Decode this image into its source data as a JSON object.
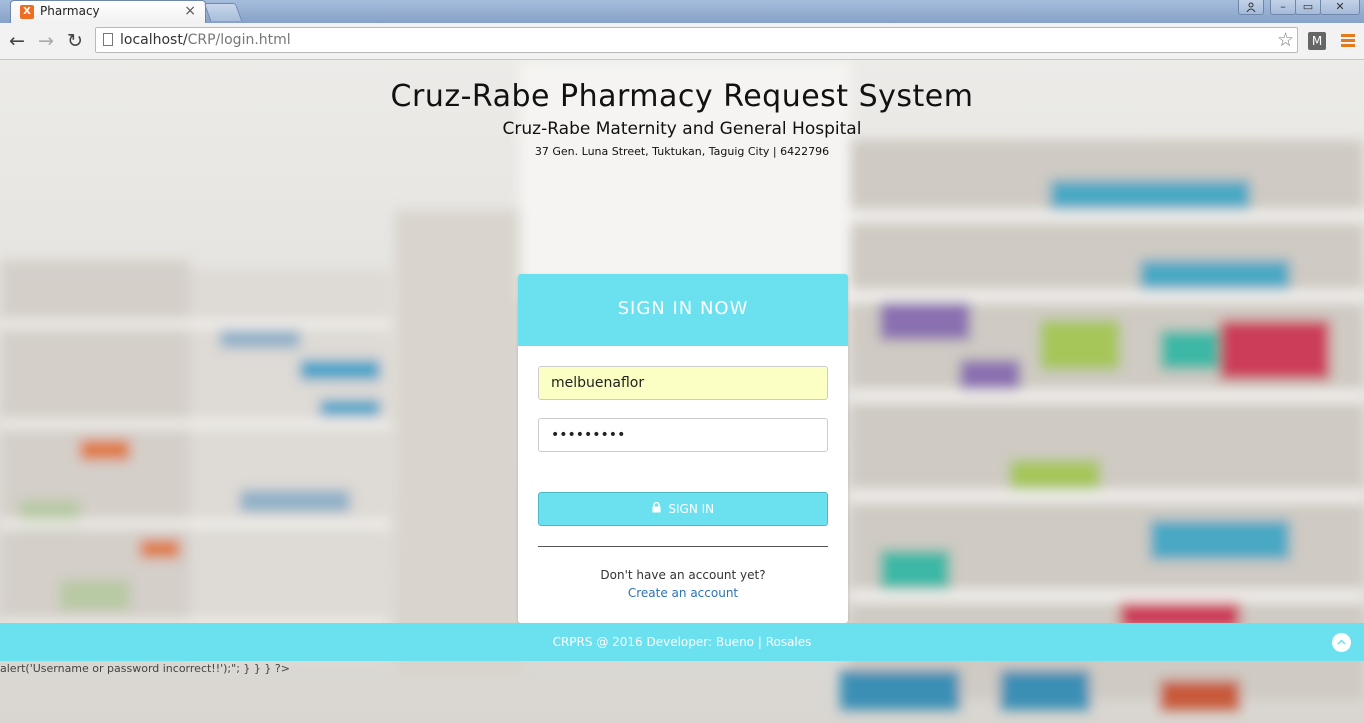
{
  "browser": {
    "tab_title": "Pharmacy",
    "tab_favicon_letter": "X",
    "tab_close": "×",
    "url_host": "localhost/",
    "url_path": "CRP/login.html",
    "back_icon": "←",
    "forward_icon": "→",
    "reload_icon": "↻",
    "star_icon": "☆",
    "extension_label": "M",
    "window_minimize": "–",
    "window_maximize": "▭",
    "window_close": "✕",
    "window_user": "👤"
  },
  "header": {
    "title": "Cruz-Rabe Pharmacy Request System",
    "subtitle": "Cruz-Rabe Maternity and General Hospital",
    "address": "37 Gen. Luna Street, Tuktukan, Taguig City | 6422796"
  },
  "login": {
    "heading": "SIGN IN NOW",
    "username_value": "melbuenaflor",
    "password_value": "•••••••••",
    "signin_label": "SIGN IN",
    "lock_icon": "🔒",
    "no_account_text": "Don't have an account yet?",
    "create_account_label": "Create an account"
  },
  "footer": {
    "text": "CRPRS @ 2016 Developer: Bueno | Rosales",
    "to_top_icon": "︿"
  },
  "debug_output": "alert('Username or password incorrect!!');\"; } } } ?>",
  "colors": {
    "accent": "#6be0ef",
    "link": "#2a73b8",
    "autofill": "#fbffc4"
  }
}
